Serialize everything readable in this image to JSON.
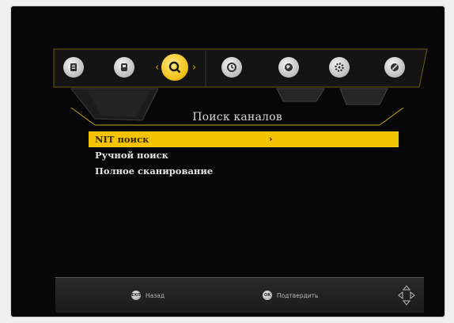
{
  "colors": {
    "accent": "#f4c400",
    "background": "#070707",
    "text": "#e2e2e2"
  },
  "top_bar": {
    "icons": [
      {
        "name": "info-icon",
        "active": false
      },
      {
        "name": "parental-icon",
        "active": false
      },
      {
        "name": "search-icon",
        "active": true
      },
      {
        "name": "clock-icon",
        "active": false
      },
      {
        "name": "globe-icon",
        "active": false
      },
      {
        "name": "settings-gear-icon",
        "active": false
      },
      {
        "name": "tools-icon",
        "active": false
      }
    ]
  },
  "page_title": "Поиск каналов",
  "menu": {
    "items": [
      {
        "label": "NIT поиск",
        "selected": true,
        "arrow": "›"
      },
      {
        "label": "Ручной поиск",
        "selected": false
      },
      {
        "label": "Полное сканирование",
        "selected": false
      }
    ]
  },
  "footer": {
    "back": {
      "key": "EXIT",
      "label": "Назад"
    },
    "confirm": {
      "key": "OK",
      "label": "Подтвердить"
    },
    "nav_icon": "dpad-icon"
  }
}
